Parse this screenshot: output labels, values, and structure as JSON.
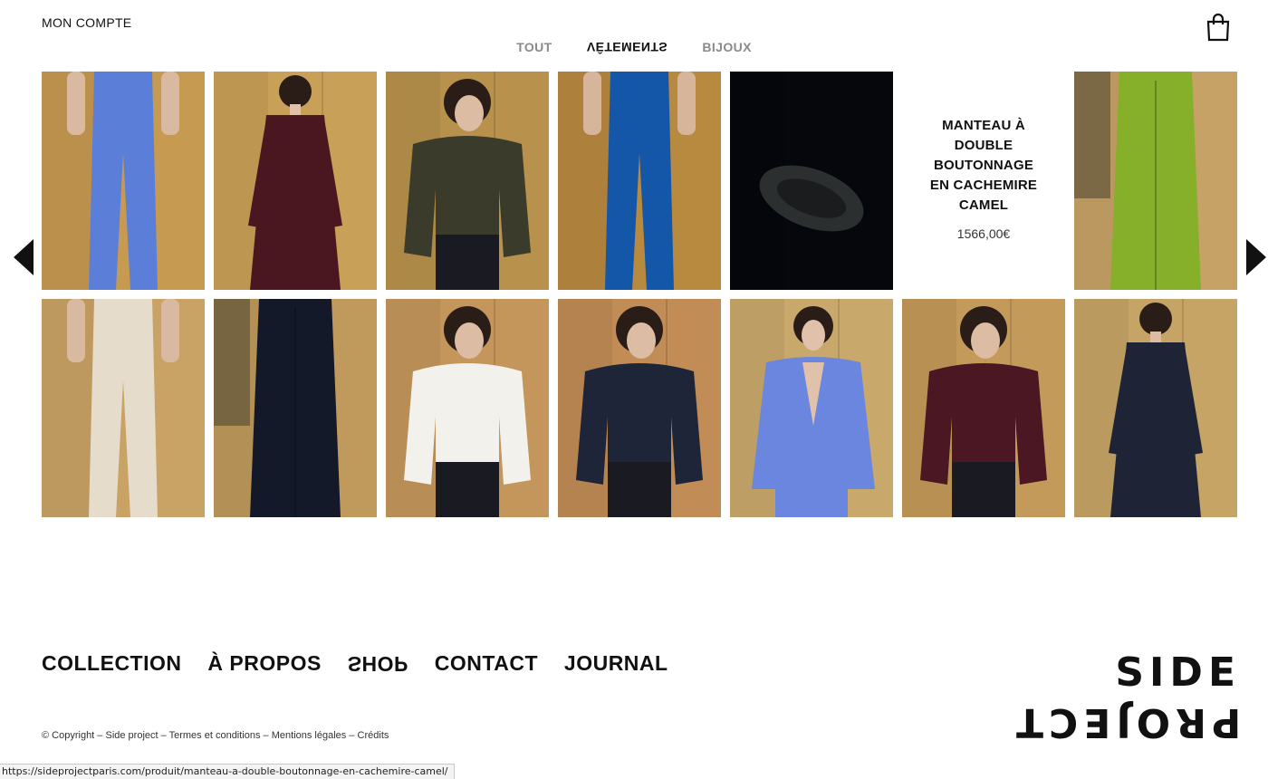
{
  "header": {
    "account_label": "MON COMPTE",
    "cart_icon": "shopping-bag-icon",
    "categories": [
      {
        "label": "TOUT",
        "active": false
      },
      {
        "label": "VÊTEMENTS",
        "active": true
      },
      {
        "label": "BIJOUX",
        "active": false
      }
    ]
  },
  "carousel": {
    "prev_icon": "triangle-left-icon",
    "next_icon": "triangle-right-icon",
    "hovered_product": {
      "name": "MANTEAU À DOUBLE BOUTONNAGE EN CACHEMIRE CAMEL",
      "price": "1566,00€"
    },
    "tiles": [
      {
        "kind": "pants",
        "bg": "#c79a52",
        "garment": "#5b7fd8",
        "skin": "#d9b9a0"
      },
      {
        "kind": "dress",
        "bg": "#c9a058",
        "garment": "#4a1720",
        "skin": "#e0c2aa"
      },
      {
        "kind": "top",
        "bg": "#b8924d",
        "garment": "#3b3b2c",
        "skin": "#dcbca3"
      },
      {
        "kind": "pants",
        "bg": "#b88a40",
        "garment": "#1456a8",
        "skin": "#d6b59b"
      },
      {
        "kind": "shoe",
        "bg": "#05070d",
        "garment": "#2c2f30",
        "skin": "#05070d"
      },
      {
        "kind": "info"
      },
      {
        "kind": "skirt",
        "bg": "#c7a266",
        "garment": "#86b02a",
        "skin": "#d8b89c"
      },
      {
        "kind": "pants",
        "bg": "#c9a365",
        "garment": "#e6dccb",
        "skin": "#d9b9a0"
      },
      {
        "kind": "skirt",
        "bg": "#bf9a5c",
        "garment": "#14192a",
        "skin": "#4b4a36"
      },
      {
        "kind": "top",
        "bg": "#c5965c",
        "garment": "#f3f1ec",
        "skin": "#dcbca3"
      },
      {
        "kind": "top",
        "bg": "#c18c55",
        "garment": "#1f2538",
        "skin": "#dcbca3"
      },
      {
        "kind": "jacket",
        "bg": "#c9a86b",
        "garment": "#6a86de",
        "skin": "#e0c2aa"
      },
      {
        "kind": "top",
        "bg": "#c49a5a",
        "garment": "#4a1722",
        "skin": "#dcbca3"
      },
      {
        "kind": "dress",
        "bg": "#c6a465",
        "garment": "#1e2435",
        "skin": "#dcbca3"
      }
    ]
  },
  "footer": {
    "nav": [
      {
        "label": "COLLECTION",
        "flip": false
      },
      {
        "label": "À PROPOS",
        "flip": false
      },
      {
        "label": "SHOP",
        "flip": true
      },
      {
        "label": "CONTACT",
        "flip": false
      },
      {
        "label": "JOURNAL",
        "flip": false
      }
    ],
    "copyright": "© Copyright",
    "separator": " – ",
    "links": [
      "Side project",
      "Termes et conditions",
      "Mentions légales",
      "Crédits"
    ],
    "logo_line1": "SIDE",
    "logo_line2": "PROJECT"
  },
  "status_bar": {
    "url": "https://sideprojectparis.com/produit/manteau-a-double-boutonnage-en-cachemire-camel/"
  }
}
